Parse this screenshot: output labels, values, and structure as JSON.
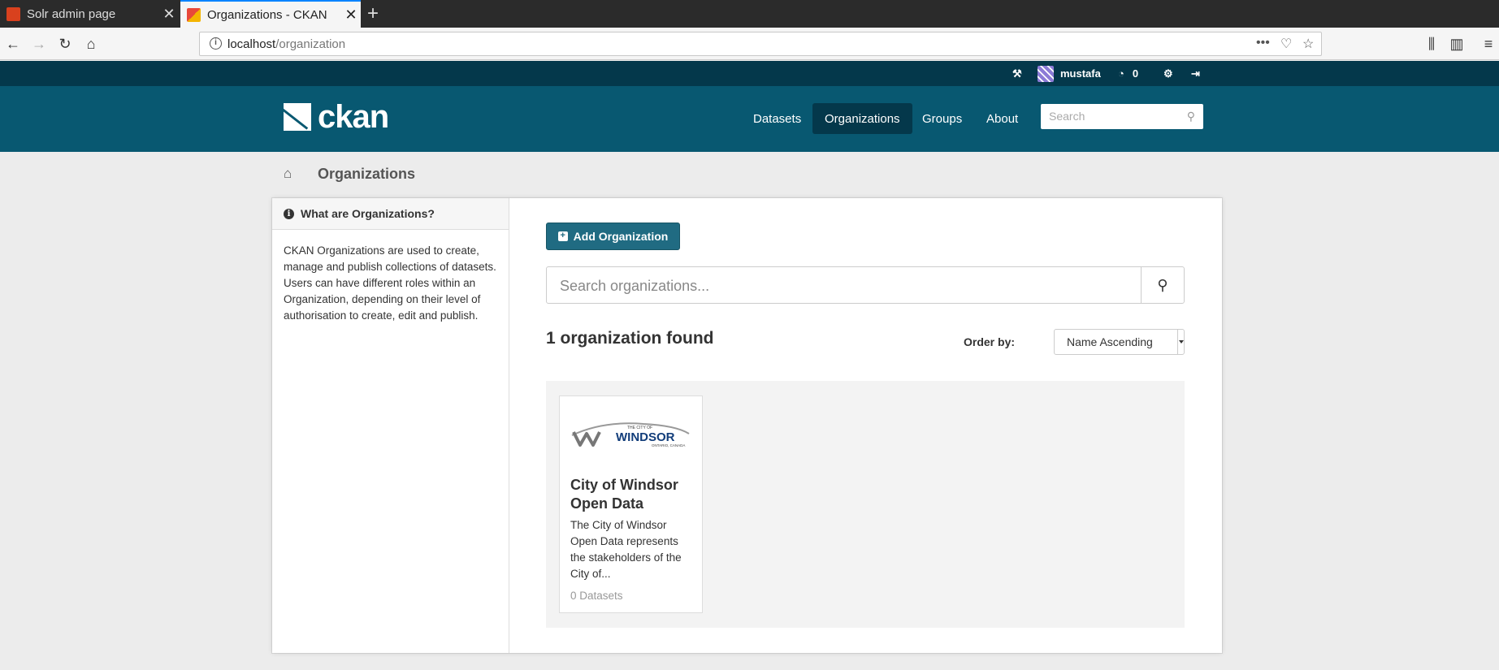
{
  "browser": {
    "tabs": [
      {
        "title": "Solr admin page"
      },
      {
        "title": "Organizations - CKAN"
      }
    ],
    "url_host": "localhost",
    "url_path": "/organization"
  },
  "account": {
    "username": "mustafa",
    "dashboard_count": "0"
  },
  "masthead": {
    "logo_text": "ckan",
    "nav": [
      "Datasets",
      "Organizations",
      "Groups",
      "About"
    ],
    "search_placeholder": "Search"
  },
  "breadcrumb": {
    "title": "Organizations"
  },
  "aside": {
    "heading": "What are Organizations?",
    "text": "CKAN Organizations are used to create, manage and publish collections of datasets. Users can have different roles within an Organization, depending on their level of authorisation to create, edit and publish."
  },
  "main": {
    "add_button": "Add Organization",
    "search_placeholder": "Search organizations...",
    "results_count": "1 organization found",
    "order_label": "Order by:",
    "order_value": "Name Ascending"
  },
  "organizations": [
    {
      "logo_text": "WINDSOR",
      "logo_small_top": "THE CITY OF",
      "logo_small_bottom": "ONTARIO, CANADA",
      "name": "City of Windsor Open Data",
      "description": "The City of Windsor Open Data represents the stakeholders of the City of...",
      "datasets": "0 Datasets"
    }
  ]
}
